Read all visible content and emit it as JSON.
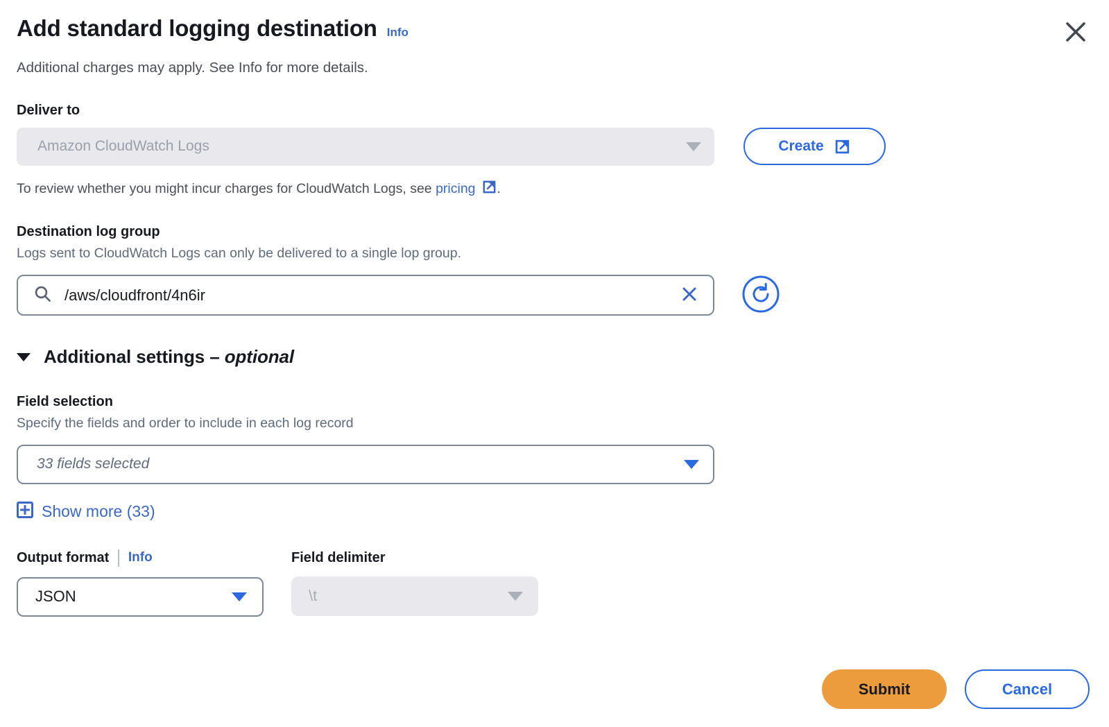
{
  "modal": {
    "title": "Add standard logging destination",
    "title_info_label": "Info",
    "subtitle": "Additional charges may apply. See Info for more details.",
    "close_icon": "close-icon"
  },
  "deliver_to": {
    "label": "Deliver to",
    "selected_value": "Amazon CloudWatch Logs",
    "disabled": true,
    "create_button_label": "Create",
    "create_button_icon": "external-link-icon",
    "helper_prefix": "To review whether you might incur charges for CloudWatch Logs, see ",
    "helper_link_label": "pricing",
    "helper_link_icon": "external-link-icon",
    "helper_suffix": "."
  },
  "destination_log_group": {
    "label": "Destination log group",
    "description": "Logs sent to CloudWatch Logs can only be delivered to a single lop group.",
    "search_icon": "search-icon",
    "value": "/aws/cloudfront/4n6ir",
    "placeholder": "",
    "clear_icon": "close-icon",
    "refresh_icon": "refresh-icon"
  },
  "additional_settings": {
    "expanded": true,
    "disclosure_icon": "triangle-down-icon",
    "title": "Additional settings ",
    "title_dash": "– ",
    "title_optional": "optional"
  },
  "field_selection": {
    "label": "Field selection",
    "description": "Specify the fields and order to include in each log record",
    "selected_summary": "33 fields selected",
    "dropdown_icon": "chevron-down-icon",
    "show_more_label": "Show more (33)",
    "show_more_icon": "plus-box-icon"
  },
  "output_format": {
    "label": "Output format",
    "info_label": "Info",
    "value": "JSON",
    "dropdown_icon": "chevron-down-icon"
  },
  "field_delimiter": {
    "label": "Field delimiter",
    "value": "\\t",
    "disabled": true,
    "dropdown_icon": "chevron-down-icon"
  },
  "footer": {
    "submit_label": "Submit",
    "cancel_label": "Cancel"
  },
  "colors": {
    "link_blue": "#3b68c4",
    "action_blue": "#2a6ade",
    "submit_orange": "#ec9c3c",
    "disabled_bg": "#e9e9ed",
    "border_grey": "#7d8998",
    "text_dark": "#16191f",
    "text_muted": "#5f6b7a"
  }
}
